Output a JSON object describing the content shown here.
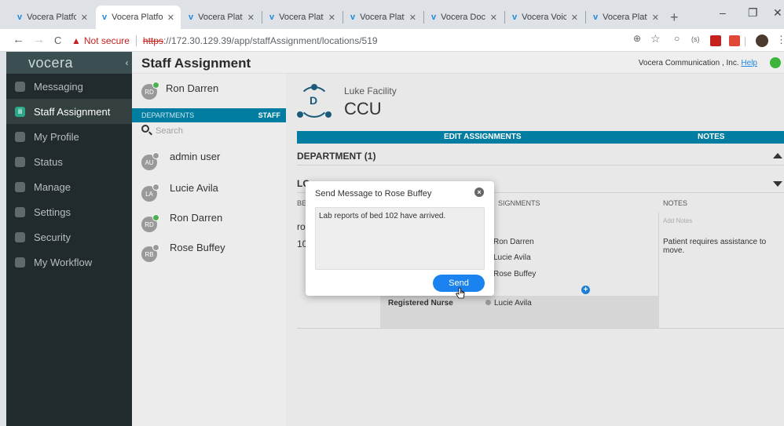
{
  "browser": {
    "tabs": [
      {
        "title": "Vocera Platform",
        "active": false
      },
      {
        "title": "Vocera Platform",
        "active": true
      },
      {
        "title": "Vocera Platform",
        "active": false
      },
      {
        "title": "Vocera Platform",
        "active": false
      },
      {
        "title": "Vocera Platform",
        "active": false
      },
      {
        "title": "Vocera Docum",
        "active": false
      },
      {
        "title": "Vocera Voice S",
        "active": false
      },
      {
        "title": "Vocera Platform",
        "active": false
      }
    ],
    "not_secure": "Not secure",
    "url_scheme": "https",
    "url_rest": "://172.30.129.39/app/staffAssignment/locations/519",
    "new_tab": "+",
    "minimize": "–",
    "restore": "❐",
    "close": "✕",
    "back": "←",
    "forward": "→",
    "reload": "C",
    "zoom": "⊕",
    "star": "☆",
    "ext_paren": "(s)",
    "menu": "⋮"
  },
  "app": {
    "logo": "vocera",
    "collapse": "‹",
    "title": "Staff Assignment",
    "company": "Vocera Communication , Inc.",
    "help": "Help",
    "status_color": "#3cb43c"
  },
  "sidebar": {
    "items": [
      {
        "label": "Messaging",
        "active": false
      },
      {
        "label": "Staff Assignment",
        "active": true
      },
      {
        "label": "My Profile",
        "active": false
      },
      {
        "label": "Status",
        "active": false
      },
      {
        "label": "Manage",
        "active": false
      },
      {
        "label": "Settings",
        "active": false
      },
      {
        "label": "Security",
        "active": false
      },
      {
        "label": "My Workflow",
        "active": false
      }
    ]
  },
  "staff_panel": {
    "current_user": {
      "initials": "RD",
      "name": "Ron Darren"
    },
    "tab_departments": "DEPARTMENTS",
    "tab_staff": "STAFF",
    "search_placeholder": "Search",
    "staff": [
      {
        "initials": "AU",
        "name": "admin user",
        "presence": "grey"
      },
      {
        "initials": "LA",
        "name": "Lucie Avila",
        "presence": "grey"
      },
      {
        "initials": "RD",
        "name": "Ron Darren",
        "presence": "green"
      },
      {
        "initials": "RB",
        "name": "Rose Buffey",
        "presence": "grey"
      }
    ]
  },
  "main": {
    "facility_letter": "D",
    "facility": "Luke Facility",
    "unit": "CCU",
    "edit_assignments": "EDIT ASSIGNMENTS",
    "notes_header": "NOTES",
    "department_section": "DEPARTMENT (1)",
    "location_section_partial": "LO",
    "col_bed_partial": "BE",
    "col_assignments_partial": "SIGNMENTS",
    "col_notes": "NOTES",
    "add_notes": "Add Notes",
    "row_prefix_1": "ro",
    "row_prefix_2": "10",
    "assignees": [
      "Ron Darren",
      "Lucie Avila",
      "Rose Buffey"
    ],
    "role": "Registered Nurse",
    "role_assignee": "Lucie Avila",
    "add": "+",
    "note": "Patient requires assistance to move."
  },
  "modal": {
    "title": "Send Message to Rose Buffey",
    "close": "×",
    "message": "Lab reports of bed 102 have arrived.",
    "send": "Send"
  }
}
